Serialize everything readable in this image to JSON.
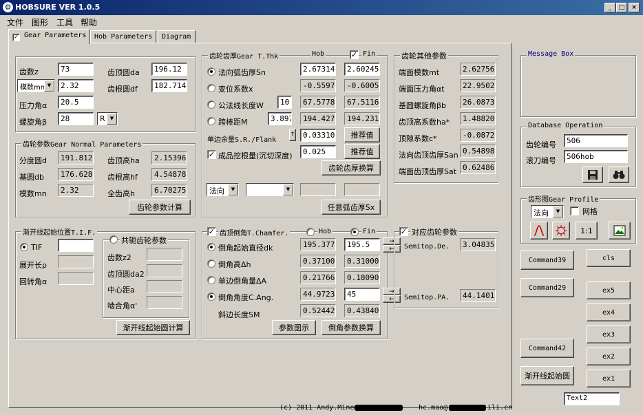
{
  "window": {
    "title": "HOBSURE VER 1.0.5",
    "min": "_",
    "max": "□",
    "close": "×"
  },
  "menu": [
    "文件",
    "图形",
    "工具",
    "帮助"
  ],
  "tabs": {
    "gear": "Gear Parameters",
    "hob": "Hob Parameters",
    "diagram": "Diagram"
  },
  "basic": {
    "z_label": "齿数z",
    "z": "73",
    "mod_select": "模数mn",
    "mod": "2.32",
    "alpha_label": "压力角α",
    "alpha": "20.5",
    "beta_label": "螺旋角β",
    "beta": "28",
    "hand": "R",
    "da_label": "齿顶圆da",
    "da": "196.12",
    "df_label": "齿根圆df",
    "df": "182.7145"
  },
  "normal": {
    "caption": "齿轮参数Gear Normal Parameters",
    "d_label": "分度圆d",
    "d": "191.8120",
    "db_label": "基圆db",
    "db": "176.6289",
    "mn_label": "模数mn",
    "mn": "2.32",
    "ha_label": "齿顶高ha",
    "ha": "2.153968",
    "hf_label": "齿根高hf",
    "hf": "4.548781",
    "h_label": "全齿高h",
    "h": "6.70275",
    "calc_btn": "齿轮参数计算"
  },
  "tif": {
    "caption": "渐开线起始位置T.I.F.",
    "tif_label": "TIF",
    "tif": "",
    "rho_label": "展开长ρ",
    "rho": "",
    "ang_label": "回转角α",
    "ang": "",
    "conj_caption": "共轭齿轮参数",
    "z2_label": "齿数z2",
    "da2_label": "齿顶圆da2",
    "a_label": "中心距a",
    "alpha2_label": "啮合角α'",
    "calc_btn": "渐开线起始圆计算"
  },
  "thk": {
    "caption": "齿轮齿厚Gear T.Thk",
    "hob_hdr": "Hob",
    "fin_hdr": "Fin",
    "sn_label": "法向弧齿厚Sn",
    "sn_hob": "2.67314",
    "sn_fin": "2.60245",
    "x_label": "变位系数x",
    "x_hob": "-0.55977",
    "x_fin": "-0.60052",
    "w_label": "公法线长度W",
    "w_k": "10",
    "w_hob": "67.57788",
    "w_fin": "67.51164",
    "m_label": "跨棒距M",
    "m_pin": "3.8970",
    "m_hob": "194.4279",
    "m_fin": "194.2310",
    "sr_label": "单边余量S.R./Flank",
    "sr": "0.033106",
    "rec_btn": "推荐值",
    "grind_label": "成品挖根量(沉切深度)",
    "grind": "0.025",
    "rec_btn2": "推荐值",
    "calc_btn": "齿轮齿厚换算",
    "dir_select": "法向",
    "sx_btn": "任意弧齿厚Sx"
  },
  "other": {
    "caption": "齿轮其他参数",
    "mt_label": "端面模数mt",
    "mt": "2.627562",
    "at_label": "端面压力角αt",
    "at": "22.95025",
    "bb_label": "基圆螺旋角βb",
    "bb": "26.08735",
    "ha_label": "齿顶高系数ha*",
    "ha": "1.488207",
    "c_label": "顶隙系数c*",
    "c": "-0.08729",
    "san_label": "法向齿顶齿厚San",
    "san": "0.548985",
    "sat_label": "端面齿顶齿厚Sat",
    "sat": "0.624868"
  },
  "chamfer": {
    "caption": "齿顶倒角T.Chamfer.",
    "hob": "Hob",
    "fin": "Fin",
    "dk_label": "倒角起始直径dk",
    "dk_hob": "195.3779",
    "dk_fin": "195.5",
    "dh_label": "倒角高Δh",
    "dh_hob": "0.371000",
    "dh_fin": "0.310000",
    "da_label": "单边倒角量ΔA",
    "da_hob": "0.217661",
    "da_fin": "0.180901",
    "ca_label": "倒角角度C.Ang.",
    "ca_hob": "44.97233",
    "ca_fin": "45",
    "sm_label": "斜边长度SM",
    "sm_hob": "0.524420",
    "sm_fin": "0.438406",
    "diagram_btn": "参数图示",
    "calc_btn": "倒角参数换算"
  },
  "corr": {
    "caption": "对应齿轮参数",
    "de_label": "Semitop.De.",
    "de": "3.048359",
    "pa_label": "Semitop.PA.",
    "pa": "44.14015",
    "arrows": "→ ←"
  },
  "message_box": {
    "caption": "Message Box"
  },
  "db": {
    "caption": "Database Operation",
    "gear_label": "齿轮编号",
    "gear": "506",
    "hob_label": "滚刀编号",
    "hob": "506hob"
  },
  "profile": {
    "caption": "齿形图Gear Profile",
    "dir": "法向",
    "grid_label": "网格",
    "scale": "1:1"
  },
  "side_buttons": {
    "command39": "Command39",
    "cls": "cls",
    "command29": "Command29",
    "ex5": "ex5",
    "ex4": "ex4",
    "ex3": "ex3",
    "command42": "Command42",
    "ex2": "ex2",
    "tif": "渐开线起始圆",
    "ex1": "ex1",
    "text2": "Text2"
  },
  "footer": {
    "copyright": "(c) 2011 Andy.Mine@",
    "email": "hc.mao@",
    "email_tail": "ili.cn"
  },
  "colors": {
    "title_start": "#0a246a",
    "title_end": "#3a6ea5",
    "face": "#d4d0c8",
    "caption_blue": "#000080"
  }
}
